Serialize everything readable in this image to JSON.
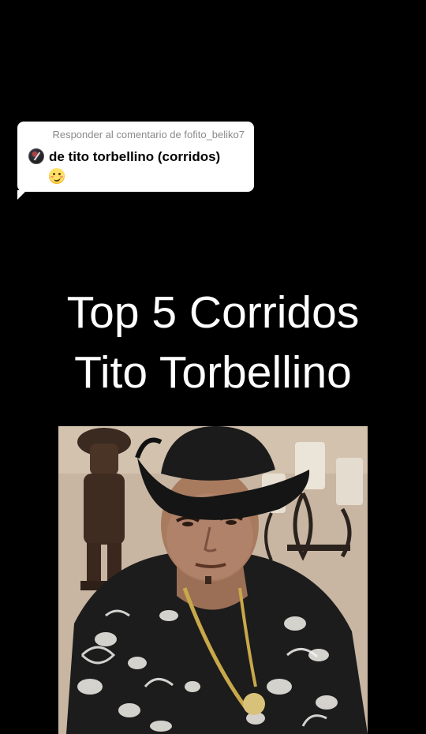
{
  "reply": {
    "header": "Responder al comentario de fofito_beliko7",
    "comment": "de tito torbellino (corridos)",
    "emoji_icon": "woozy-face-icon",
    "avatar_icon": "user-avatar"
  },
  "title": {
    "line1": "Top 5 Corridos",
    "line2": "Tito Torbellino"
  },
  "photo": {
    "subject": "man-in-black-cowboy-hat-photo"
  },
  "colors": {
    "background": "#000000",
    "bubble": "#ffffff",
    "bubble_header": "#8a8a8a",
    "title_text": "#ffffff"
  }
}
